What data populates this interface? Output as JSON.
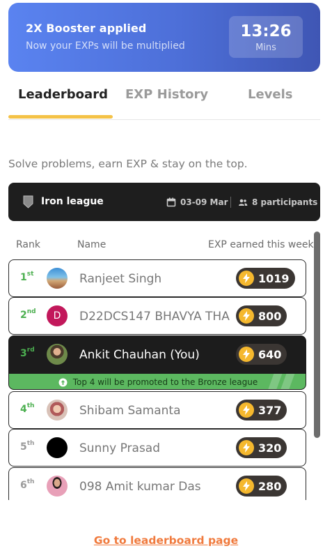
{
  "booster": {
    "title": "2X Booster applied",
    "subtitle": "Now your EXPs will be multiplied",
    "timer_value": "13:26",
    "timer_unit": "Mins"
  },
  "tabs": [
    {
      "label": "Leaderboard",
      "active": true
    },
    {
      "label": "EXP History",
      "active": false
    },
    {
      "label": "Levels",
      "active": false
    }
  ],
  "intro_text": "Solve problems, earn EXP & stay on the top.",
  "league": {
    "name": "Iron league",
    "dates": "03-09 Mar",
    "participants": "8 participants"
  },
  "columns": {
    "rank": "Rank",
    "name": "Name",
    "exp": "EXP earned this week"
  },
  "rows": [
    {
      "rank": "1",
      "suffix": "st",
      "name": "Ranjeet Singh",
      "exp": "1019",
      "avatar": "photo-landscape",
      "current": false
    },
    {
      "rank": "2",
      "suffix": "nd",
      "name": "D22DCS147 BHAVYA THAKKAR",
      "exp": "800",
      "avatar": "initial",
      "avatar_letter": "D",
      "current": false
    },
    {
      "rank": "3",
      "suffix": "rd",
      "name": "Ankit Chauhan (You)",
      "exp": "640",
      "avatar": "photo-person",
      "current": true
    },
    {
      "rank": "4",
      "suffix": "th",
      "name": "Shibam Samanta",
      "exp": "377",
      "avatar": "photo-group",
      "current": false
    },
    {
      "rank": "5",
      "suffix": "th",
      "name": "Sunny Prasad",
      "exp": "320",
      "avatar": "black-circle",
      "current": false
    },
    {
      "rank": "6",
      "suffix": "th",
      "name": "098 Amit kumar Das",
      "exp": "280",
      "avatar": "photo-person-pink",
      "current": false
    }
  ],
  "promotion_text": "Top 4 will be promoted to the Bronze league",
  "cta": "Go to leaderboard page",
  "colors": {
    "accent_orange": "#f07a3d",
    "tab_underline": "#f4c247",
    "rank_green": "#4caf50",
    "promo_green": "#5cb860",
    "bolt_yellow": "#f5b82e"
  }
}
